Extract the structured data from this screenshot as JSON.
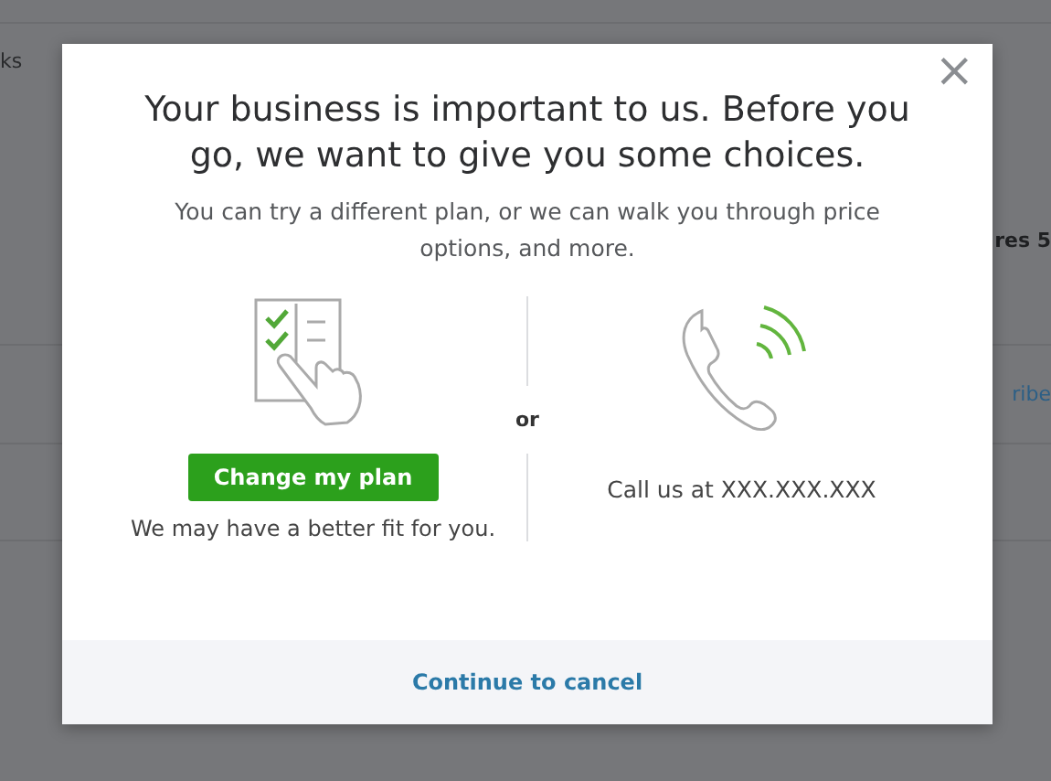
{
  "background": {
    "rows": [
      {
        "left": "ks",
        "right": "res 5"
      },
      {
        "left": "",
        "right": "ribe"
      },
      {
        "left": "",
        "right": ""
      },
      {
        "left": "",
        "right": ""
      }
    ]
  },
  "dialog": {
    "close": "×",
    "title": "Your business is important to us. Before you go, we want to give you some choices.",
    "subtitle": "You can try a different plan, or we can walk you through price options, and more.",
    "left": {
      "button": "Change my plan",
      "note": "We may have a better fit for you."
    },
    "separator": "or",
    "right": {
      "text": "Call us at XXX.XXX.XXX"
    },
    "footer_link": "Continue to cancel"
  }
}
